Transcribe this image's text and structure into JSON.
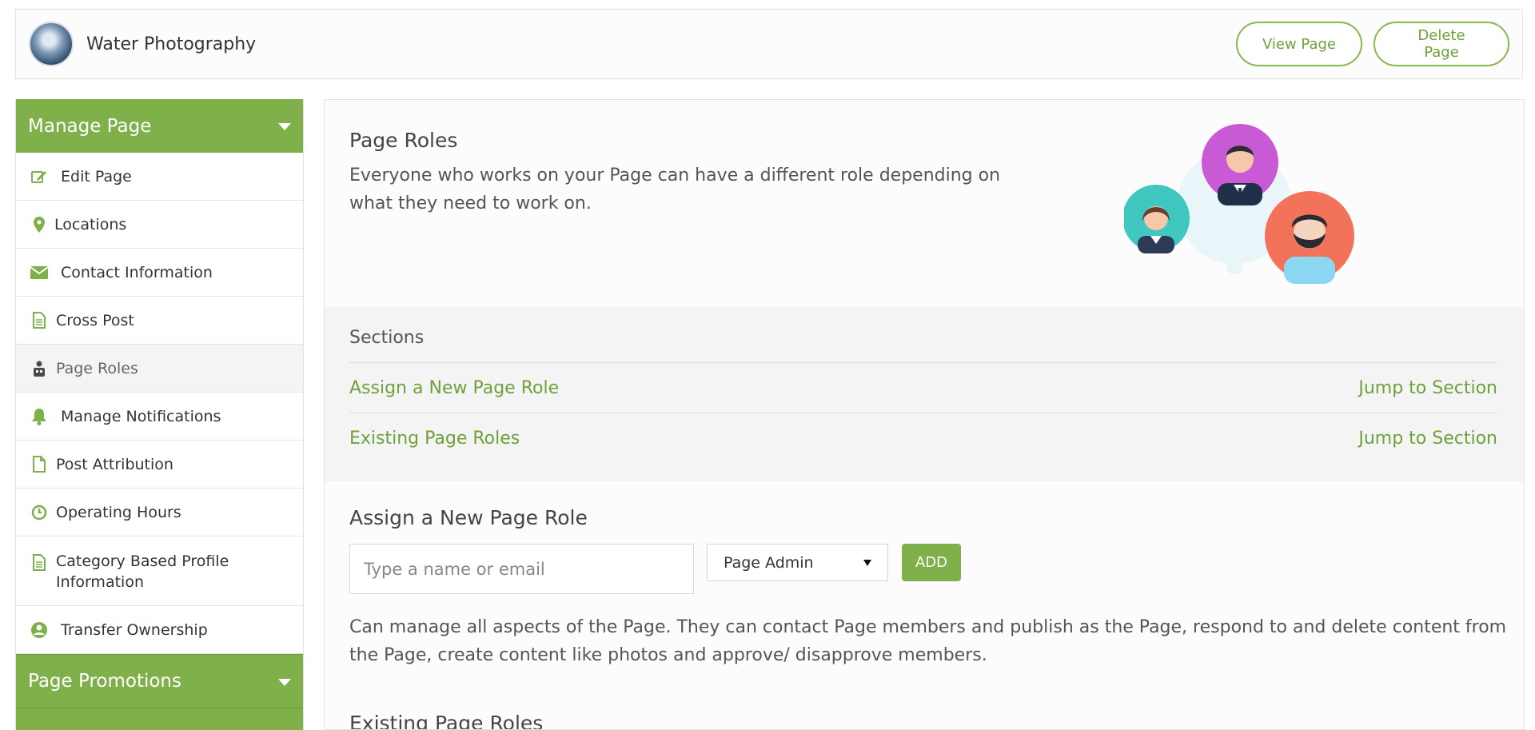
{
  "header": {
    "page_name": "Water Photography",
    "view_button": "View Page",
    "delete_button": "Delete Page"
  },
  "sidebar": {
    "manage_title": "Manage Page",
    "items": [
      {
        "label": "Edit Page",
        "icon": "edit-icon"
      },
      {
        "label": "Locations",
        "icon": "location-pin-icon"
      },
      {
        "label": "Contact Information",
        "icon": "envelope-icon"
      },
      {
        "label": "Cross Post",
        "icon": "document-icon"
      },
      {
        "label": "Page Roles",
        "icon": "page-roles-icon",
        "active": true
      },
      {
        "label": "Manage Notifications",
        "icon": "bell-icon"
      },
      {
        "label": "Post Attribution",
        "icon": "file-icon"
      },
      {
        "label": "Operating Hours",
        "icon": "clock-icon"
      },
      {
        "label": "Category Based Profile Information",
        "icon": "document-icon"
      },
      {
        "label": "Transfer Ownership",
        "icon": "user-circle-icon"
      }
    ],
    "promotions_title": "Page Promotions"
  },
  "intro": {
    "title": "Page Roles",
    "description": "Everyone who works on your Page can have a different role depending on what they need to work on."
  },
  "sections": {
    "title": "Sections",
    "rows": [
      {
        "name": "Assign a New Page Role",
        "action": "Jump to Section"
      },
      {
        "name": "Existing Page Roles",
        "action": "Jump to Section"
      }
    ]
  },
  "assign": {
    "title": "Assign a New Page Role",
    "input_placeholder": "Type a name or email",
    "role_value": "Page Admin",
    "add_button": "ADD",
    "description": "Can manage all aspects of the Page. They can contact Page members and publish as the Page, respond to and delete content from the Page, create content like photos and approve/ disapprove members."
  },
  "existing": {
    "title": "Existing Page Roles"
  },
  "colors": {
    "accent": "#7fb04a",
    "accent_text": "#6fa13b"
  }
}
